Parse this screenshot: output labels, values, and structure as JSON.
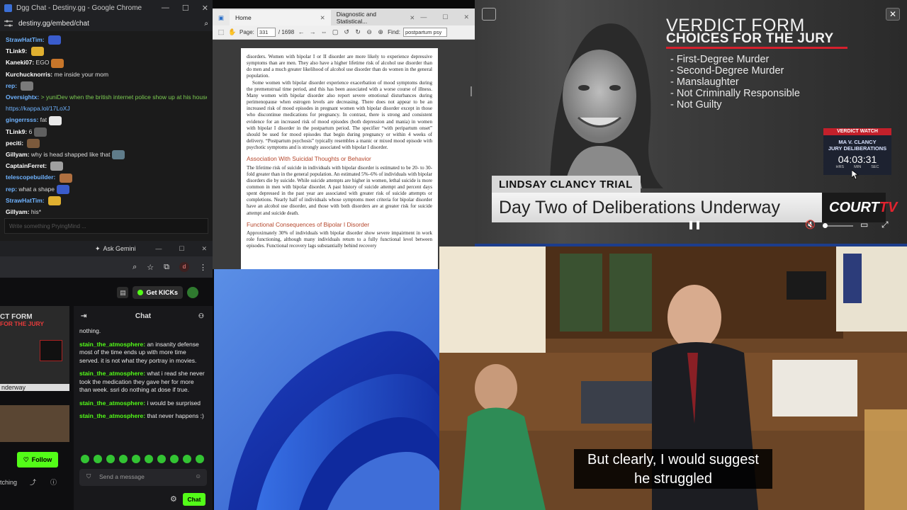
{
  "dgg": {
    "tab_title": "Dgg Chat - Destiny.gg - Google Chrome",
    "url": "destiny.gg/embed/chat",
    "input_placeholder": "Write something PryingMind ...",
    "messages": [
      {
        "user": "StrawHatTim:",
        "text": "",
        "color": "#6fb3ff"
      },
      {
        "user": "TLink9:",
        "text": "",
        "color": "#ffffff"
      },
      {
        "user": "Kaneki07:",
        "text": "EGO",
        "color": "#ffffff"
      },
      {
        "user": "Kurchucknorris:",
        "text": "me inside your mom",
        "color": "#ffffff"
      },
      {
        "user": "rep:",
        "text": "",
        "color": "#6fb3ff"
      },
      {
        "user": "Oversightx:",
        "text": "> yuniDev when the british internet police show up at his house",
        "color": "#6fb3ff",
        "text_color": "#7ccc52"
      },
      {
        "user": "",
        "text": "https://kappa.lol/17LoXJ",
        "color": "#6fb3ff",
        "text_color": "#6fb3ff"
      },
      {
        "user": "gingerrsss:",
        "text": "fat",
        "color": "#6fb3ff"
      },
      {
        "user": "TLink9:",
        "text": "6",
        "color": "#ffffff"
      },
      {
        "user": "peciti:",
        "text": "",
        "color": "#ffffff"
      },
      {
        "user": "Gillyam:",
        "text": "why is head shapped like that",
        "color": "#ffffff"
      },
      {
        "user": "CaptainFerret:",
        "text": "",
        "color": "#ffffff"
      },
      {
        "user": "telescopebuilder:",
        "text": "",
        "color": "#6fb3ff"
      },
      {
        "user": "rep:",
        "text": "what a shape",
        "color": "#6fb3ff"
      },
      {
        "user": "StrawHatTim:",
        "text": "",
        "color": "#6fb3ff"
      },
      {
        "user": "Gillyam:",
        "text": "his*",
        "color": "#ffffff"
      }
    ]
  },
  "kick": {
    "ask_gemini": "Ask Gemini",
    "avatar_letter": "d",
    "get_kicks": "Get KICKs",
    "chat_title": "Chat",
    "preview_line1": "CT FORM",
    "preview_line2": "FOR THE JURY",
    "preview_lower": "nderway",
    "follow": "Follow",
    "watching": "tching",
    "messages": [
      {
        "user": "",
        "text": "nothing."
      },
      {
        "user": "stain_the_atmosphere:",
        "text": "an insanity defense most of the time ends up with more time served. it is not what they portray in movies."
      },
      {
        "user": "stain_the_atmosphere:",
        "text": "what i read she never took the medication they gave her for more than week. ssri do nothing at dose if true."
      },
      {
        "user": "stain_the_atmosphere:",
        "text": "i would be surprised"
      },
      {
        "user": "stain_the_atmosphere:",
        "text": "that never happens :)"
      }
    ],
    "send_placeholder": "Send a message",
    "chat_button": "Chat"
  },
  "pdf": {
    "tab_home": "Home",
    "tab_doc": "Diagnostic and Statistical...",
    "page_label": "Page:",
    "page_current": "331",
    "page_total": "/ 1698",
    "find_label": "Find:",
    "find_value": "postpartum psy",
    "para1": "disorders. Women with bipolar I or II disorder are more likely to experience depressive symptoms than are men. They also have a higher lifetime risk of alcohol use disorder than do men and a much greater likelihood of alcohol use disorder than do women in the general population.",
    "para2": "Some women with bipolar disorder experience exacerbation of mood symptoms during the premenstrual time period, and this has been associated with a worse course of illness. Many women with bipolar disorder also report severe emotional disturbances during perimenopause when estrogen levels are decreasing. There does not appear to be an increased risk of mood episodes in pregnant women with bipolar disorder except in those who discontinue medications for pregnancy. In contrast, there is strong and consistent evidence for an increased risk of mood episodes (both depression and mania) in women with bipolar I disorder in the postpartum period. The specifier “with peripartum onset” should be used for mood episodes that begin during pregnancy or within 4 weeks of delivery. “Postpartum psychosis” typically resembles a manic or mixed mood episode with psychotic symptoms and is strongly associated with bipolar I disorder.",
    "heading1": "Association With Suicidal Thoughts or Behavior",
    "para3": "The lifetime risk of suicide in individuals with bipolar disorder is estimated to be 20- to 30-fold greater than in the general population. An estimated 5%–6% of individuals with bipolar disorders die by suicide. While suicide attempts are higher in women, lethal suicide is more common in men with bipolar disorder. A past history of suicide attempt and percent days spent depressed in the past year are associated with greater risk of suicide attempts or completions. Nearly half of individuals whose symptoms meet criteria for bipolar disorder have an alcohol use disorder, and those with both disorders are at greater risk for suicide attempt and suicide death.",
    "heading2": "Functional Consequences of Bipolar I Disorder",
    "para4": "Approximately 30% of individuals with bipolar disorder show severe impairment in work role functioning, although many individuals return to a fully functional level between episodes. Functional recovery lags substantially behind recovery"
  },
  "courttv": {
    "title1": "VERDICT FORM",
    "title2": "CHOICES FOR THE JURY",
    "choices": [
      "- First-Degree Murder",
      "- Second-Degree Murder",
      "- Manslaughter",
      "- Not Criminally Responsible",
      "- Not Guilty"
    ],
    "watch_header": "VERDICT WATCH",
    "watch_name1": "MA V. CLANCY",
    "watch_name2": "JURY DELIBERATIONS",
    "watch_time": "04:03:31",
    "watch_hrs": "HRS",
    "watch_min": "MIN",
    "watch_sec": "SEC",
    "trial_tag": "LINDSAY CLANCY TRIAL",
    "headline": "Day Two of Deliberations Underway",
    "logo_court": "COURT",
    "logo_tv": "TV",
    "accent": "#d6202d"
  },
  "court": {
    "caption_line1": "But clearly, I would suggest",
    "caption_line2": "he struggled"
  }
}
